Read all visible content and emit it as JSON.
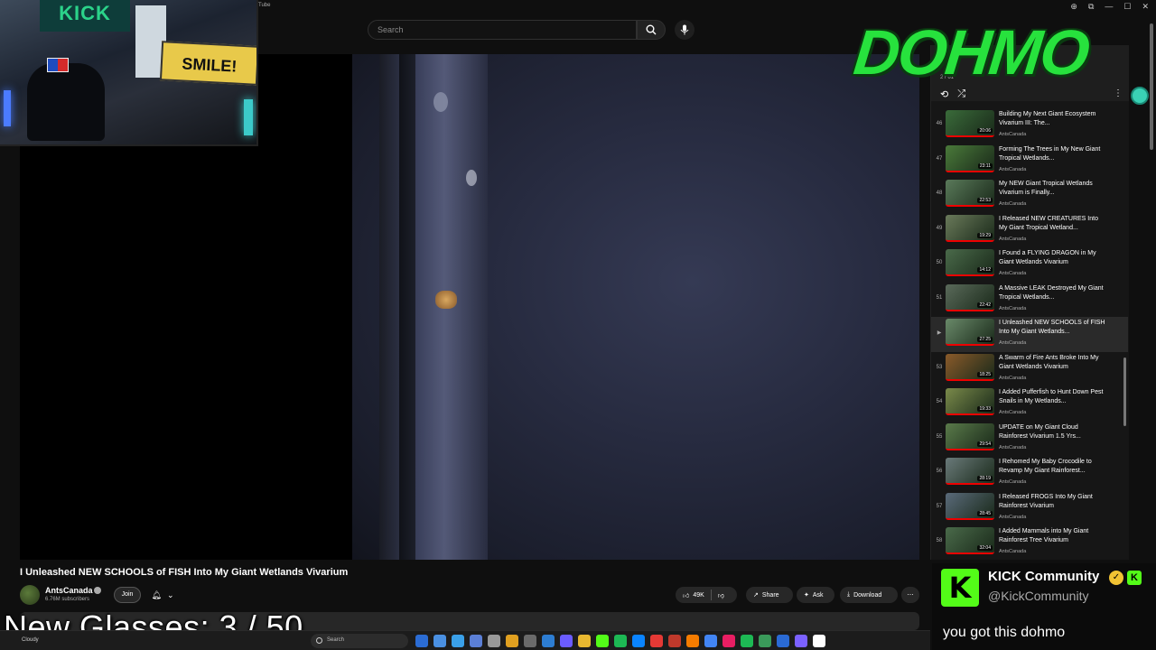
{
  "window": {
    "title": "Tube",
    "controls": [
      "zoom",
      "extensions",
      "minimize",
      "maximize",
      "close"
    ]
  },
  "search": {
    "placeholder": "Search"
  },
  "webcam": {
    "banner_text": "KICK",
    "sign_text": "SMILE!"
  },
  "video": {
    "title": "I Unleashed NEW SCHOOLS of FISH Into My Giant Wetlands Vivarium",
    "channel": "AntsCanada",
    "subscribers": "6.76M subscribers",
    "join_label": "Join",
    "likes": "49K",
    "share_label": "Share",
    "ask_label": "Ask",
    "download_label": "Download"
  },
  "overlay": {
    "glasses_counter": "New Glasses:  3 / 50"
  },
  "playlist": {
    "title": "",
    "position": "2 / 61",
    "items": [
      {
        "num": "46",
        "title": "Building My Next Giant Ecosystem Vivarium III: The...",
        "channel": "AntsCanada",
        "duration": "20:06",
        "color": "#3a6b3a"
      },
      {
        "num": "47",
        "title": "Forming The Trees in My New Giant Tropical Wetlands...",
        "channel": "AntsCanada",
        "duration": "23:11",
        "color": "#4a7a3a"
      },
      {
        "num": "48",
        "title": "My NEW Giant Tropical Wetlands Vivarium is Finally...",
        "channel": "AntsCanada",
        "duration": "22:53",
        "color": "#5a7a5a"
      },
      {
        "num": "49",
        "title": "I Released NEW CREATURES Into My Giant Tropical Wetland...",
        "channel": "AntsCanada",
        "duration": "19:29",
        "color": "#6a7a5a"
      },
      {
        "num": "50",
        "title": "I Found a FLYING DRAGON in My Giant Wetlands Vivarium",
        "channel": "AntsCanada",
        "duration": "14:12",
        "color": "#4a6a4a"
      },
      {
        "num": "51",
        "title": "A Massive LEAK Destroyed My Giant Tropical Wetlands...",
        "channel": "AntsCanada",
        "duration": "22:42",
        "color": "#5a6a5a"
      },
      {
        "num": "▶",
        "title": "I Unleashed NEW SCHOOLS of FISH Into My Giant Wetlands...",
        "channel": "AntsCanada",
        "duration": "27:25",
        "color": "#6a8a6a",
        "active": true
      },
      {
        "num": "53",
        "title": "A Swarm of Fire Ants Broke Into My Giant Wetlands Vivarium",
        "channel": "AntsCanada",
        "duration": "18:25",
        "color": "#8a5a2a"
      },
      {
        "num": "54",
        "title": "I Added Pufferfish to Hunt Down Pest Snails in My Wetlands...",
        "channel": "AntsCanada",
        "duration": "19:33",
        "color": "#7a8a4a"
      },
      {
        "num": "55",
        "title": "UPDATE on My Giant Cloud Rainforest Vivarium 1.5 Yrs...",
        "channel": "AntsCanada",
        "duration": "29:54",
        "color": "#5a7a4a"
      },
      {
        "num": "56",
        "title": "I Rehomed My Baby Crocodile to Revamp My Giant Rainforest...",
        "channel": "AntsCanada",
        "duration": "28:19",
        "color": "#6a7a7a"
      },
      {
        "num": "57",
        "title": "I Released FROGS Into My Giant Rainforest Vivarium",
        "channel": "AntsCanada",
        "duration": "28:45",
        "color": "#5a6a7a"
      },
      {
        "num": "58",
        "title": "I Added Mammals into My Giant Rainforest Tree Vivarium",
        "channel": "AntsCanada",
        "duration": "32:04",
        "color": "#4a6a4a"
      }
    ]
  },
  "taskbar": {
    "weather": "Cloudy",
    "search_label": "Search",
    "icons": [
      "#2b6cd4",
      "#4a90e2",
      "#3aa0e8",
      "#5b7fd6",
      "#999999",
      "#e0a020",
      "#6a6a6a",
      "#2d7dd2",
      "#6b5cff",
      "#e8b830",
      "#53fc18",
      "#1db954",
      "#0a84ff",
      "#e53935",
      "#c0392b",
      "#f57c00",
      "#4285f4",
      "#e91e63",
      "#1db954",
      "#3a9a5a",
      "#2a6ad4",
      "#7b61ff",
      "#ffffff"
    ]
  },
  "logo": {
    "text": "DOHMO"
  },
  "chat": {
    "name": "KICK Community",
    "handle": "@KickCommunity",
    "message": "you got this dohmo",
    "kick_letter": "K"
  },
  "colors": {
    "kick_green": "#53fc18",
    "logo_green": "#27e23d",
    "accent_red": "#ff0000"
  }
}
